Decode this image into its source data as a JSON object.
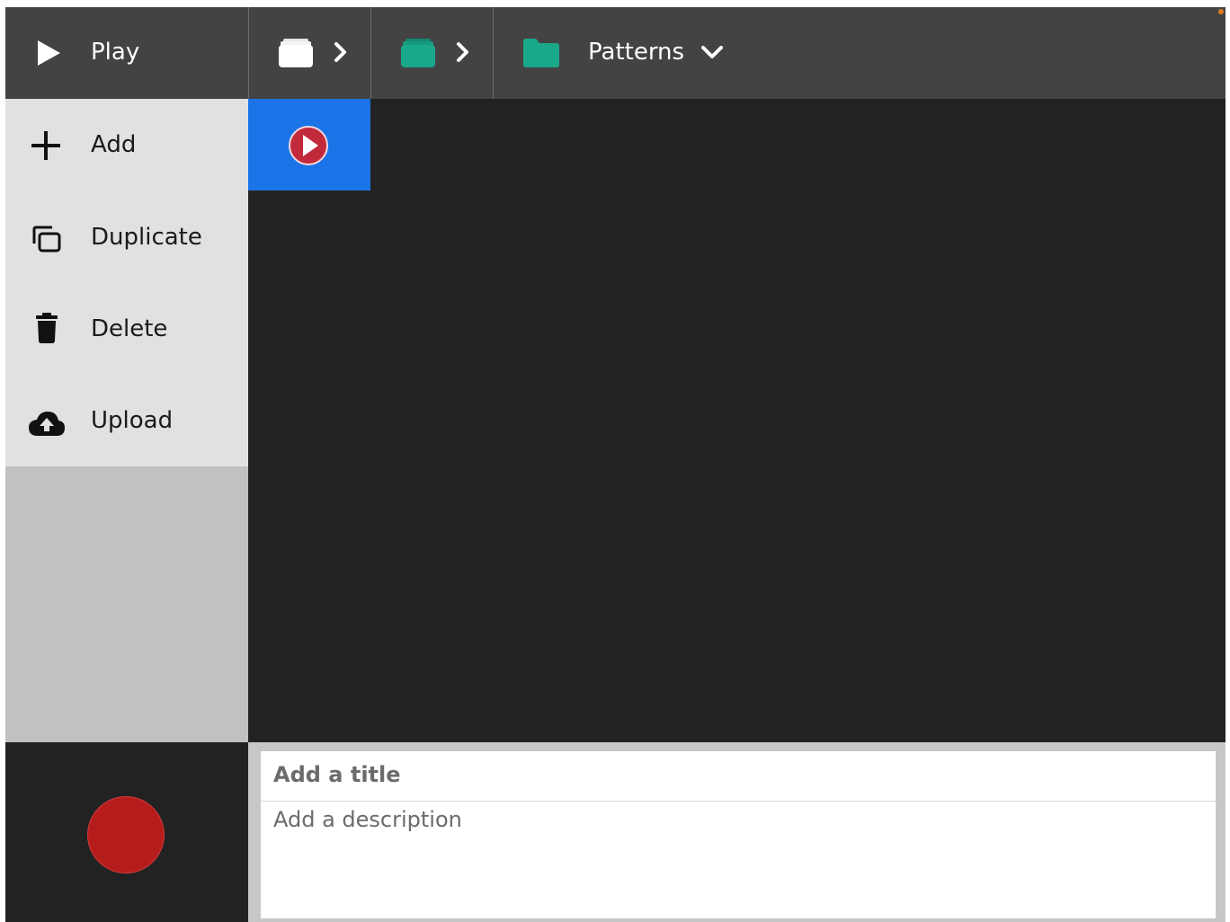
{
  "toolbar": {
    "play_label": "Play"
  },
  "breadcrumb": {
    "root_icon": "folder-white-icon",
    "sub_icon": "folder-teal-icon",
    "current_label": "Patterns",
    "folder_color": "#1aa88a"
  },
  "sidebar": {
    "items": [
      {
        "label": "Add",
        "icon": "plus-icon"
      },
      {
        "label": "Duplicate",
        "icon": "duplicate-icon"
      },
      {
        "label": "Delete",
        "icon": "trash-icon"
      },
      {
        "label": "Upload",
        "icon": "cloud-upload-icon"
      }
    ]
  },
  "main": {
    "selected_tile_icon": "play-circle-icon",
    "selected_color": "#1a74e8"
  },
  "record": {
    "icon": "record-button",
    "color": "#b51c1c"
  },
  "details": {
    "title_placeholder": "Add a title",
    "description_placeholder": "Add a description"
  }
}
